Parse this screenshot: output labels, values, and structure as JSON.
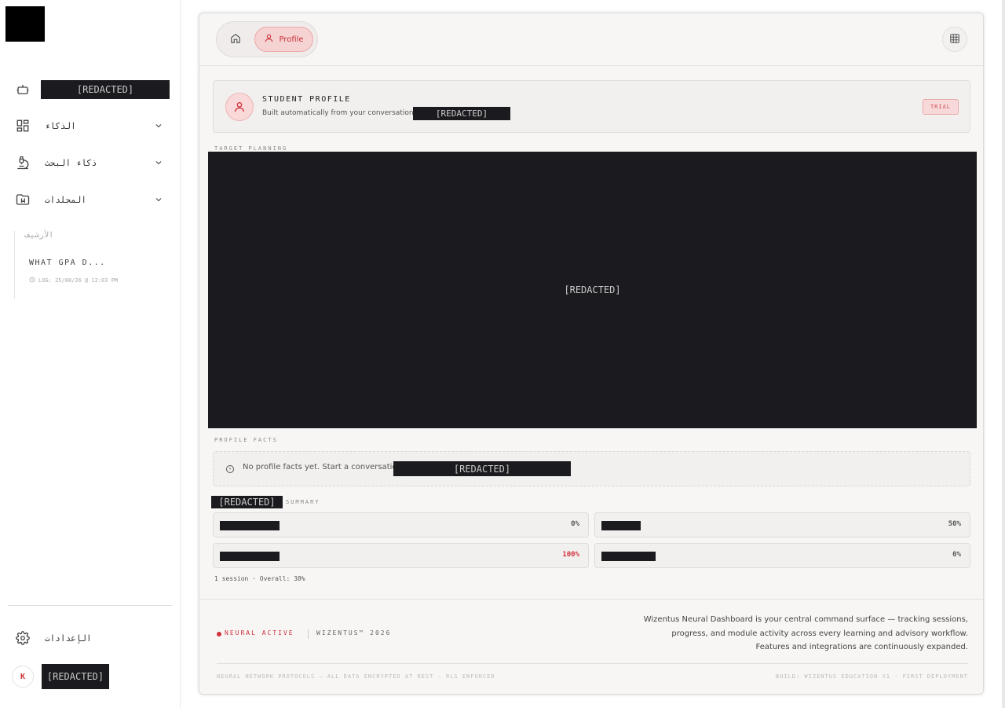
{
  "redacted_text": "[REDACTED]",
  "sidebar": {
    "items": [
      {
        "label": "[REDACTED]",
        "icon": "robot-icon"
      },
      {
        "label": "الذكاء",
        "icon": "dashboard-icon"
      },
      {
        "label": "ذكاء البحث",
        "icon": "microscope-icon"
      },
      {
        "label": "المجلدات",
        "icon": "folder-bookmark-icon"
      }
    ],
    "history": {
      "title": "الأرشيف",
      "item": "WHAT GPA D...",
      "meta": "LOG: 25/08/26 @ 12:03 PM"
    },
    "settings_label": "الإعدادات",
    "user_initial": "K",
    "user_name": "[REDACTED]"
  },
  "topbar": {
    "profile_tab": "Profile"
  },
  "profile_card": {
    "title": "STUDENT PROFILE",
    "subtitle": "Built automatically from your conversations",
    "subtitle_redacted": "[REDACTED]",
    "badge": "TRIAL"
  },
  "sections": {
    "target_planning": "TARGET PLANNING",
    "target_planning_content": "[REDACTED]",
    "profile_facts": "PROFILE FACTS",
    "summary": "SUMMARY",
    "summary_redacted": "[REDACTED]"
  },
  "facts": {
    "empty_text": "No profile facts yet. Start a conversation",
    "empty_redacted": "[REDACTED]"
  },
  "stats": [
    {
      "value": "0%",
      "highlight": false
    },
    {
      "value": "50%",
      "highlight": false
    },
    {
      "value": "100%",
      "highlight": true
    },
    {
      "value": "0%",
      "highlight": false
    }
  ],
  "overall": "1 session · Overall: 38%",
  "footer": {
    "status": "NEURAL ACTIVE",
    "brand": "WIZENTUS™ 2026",
    "description_lines": [
      "Wizentus Neural Dashboard is your central command surface — tracking sessions,",
      "progress, and module activity across every learning and advisory workflow.",
      "Features and integrations are continuously expanded."
    ],
    "legal": "NEURAL NETWORK PROTOCOLS — ALL DATA ENCRYPTED AT REST · RLS ENFORCED",
    "build": "BUILD: WIZENTUS EDUCATION V1 · FIRST DEPLOYMENT"
  },
  "colors": {
    "accent": "#d0313a",
    "redaction": "#1b1a1e",
    "panel": "#f7f6f5"
  }
}
